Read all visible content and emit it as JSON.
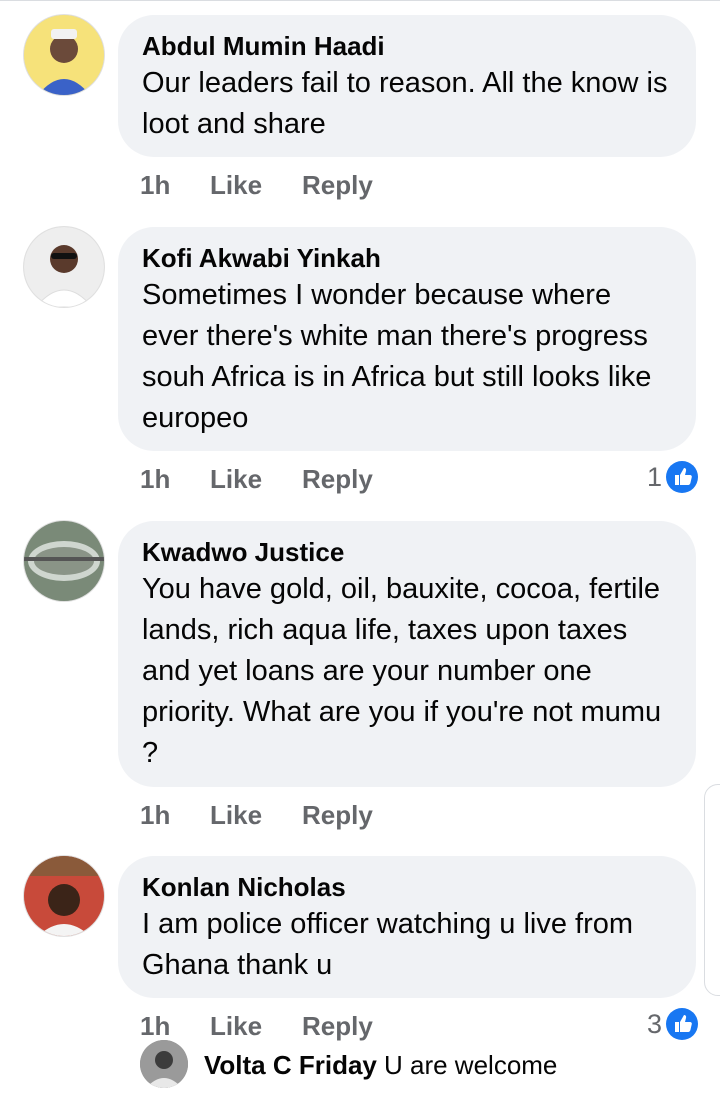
{
  "comments": [
    {
      "author": "Abdul Mumin Haadi",
      "text": "Our leaders fail to reason. All the know is loot and share",
      "time": "1h",
      "like_label": "Like",
      "reply_label": "Reply",
      "reaction_count": null
    },
    {
      "author": "Kofi Akwabi Yinkah",
      "text": "Sometimes I wonder because where ever there's white man there's progress souh Africa is in Africa but still looks like europeo",
      "time": "1h",
      "like_label": "Like",
      "reply_label": "Reply",
      "reaction_count": "1"
    },
    {
      "author": "Kwadwo Justice",
      "text": "You have gold, oil, bauxite, cocoa, fertile lands, rich aqua life,  taxes upon taxes and yet loans are your number one priority. What are you if you're not mumu ?",
      "time": "1h",
      "like_label": "Like",
      "reply_label": "Reply",
      "reaction_count": null
    },
    {
      "author": "Konlan Nicholas",
      "text": "I am police officer watching u live from Ghana thank u",
      "time": "1h",
      "like_label": "Like",
      "reply_label": "Reply",
      "reaction_count": "3"
    }
  ],
  "reply_preview": {
    "author": "Volta C Friday",
    "text": "U are welcome"
  },
  "colors": {
    "bubble": "#f0f2f5",
    "meta": "#65676b",
    "like_blue": "#1877f2"
  },
  "icons": {
    "reaction": "like-thumb-icon"
  }
}
